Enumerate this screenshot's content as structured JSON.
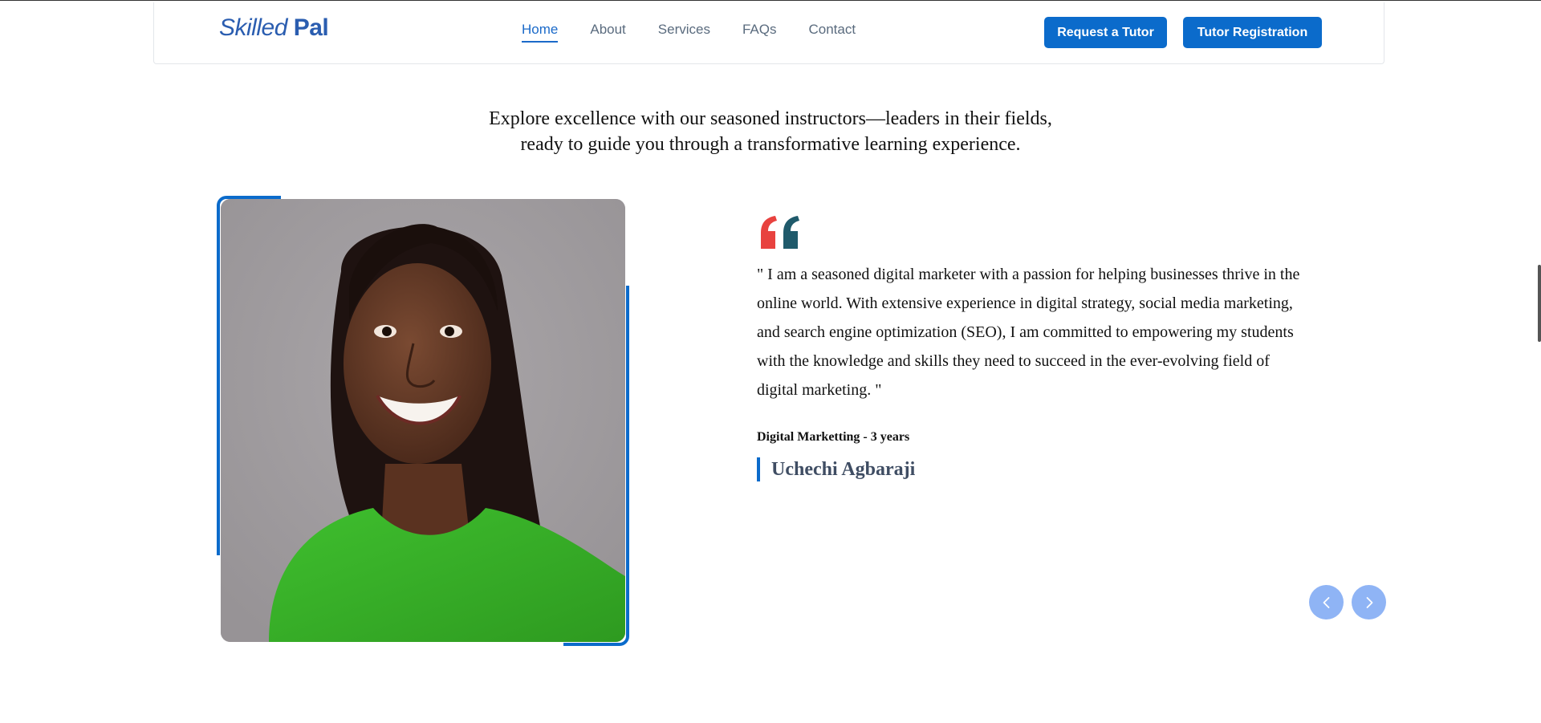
{
  "nav": {
    "logo_part1": "Skilled",
    "logo_part2": "Pal",
    "links": [
      "Home",
      "About",
      "Services",
      "FAQs",
      "Contact"
    ],
    "active": "Home",
    "request_label": "Request a Tutor",
    "register_label": "Tutor Registration"
  },
  "intro": {
    "line1": "Explore excellence with our seasoned instructors—leaders in their fields,",
    "line2": "ready to guide you through a transformative learning experience."
  },
  "testimonial": {
    "quote": "\" I am a seasoned digital marketer with a passion for helping businesses thrive in the online world. With extensive experience in digital strategy, social media marketing, and search engine optimization (SEO), I am committed to empowering my students with the knowledge and skills they need to succeed in the ever-evolving field of digital marketing. \"",
    "subject": "Digital Marketting - 3 years",
    "name": "Uchechi Agbaraji"
  },
  "icons": {
    "quote": "quote-mark-icon",
    "prev": "chevron-left-icon",
    "next": "chevron-right-icon"
  },
  "colors": {
    "brand": "#0b6bcb",
    "quote_red": "#e8423f",
    "quote_teal": "#1f5a6b",
    "arrow_bg": "#8fb4f5"
  }
}
